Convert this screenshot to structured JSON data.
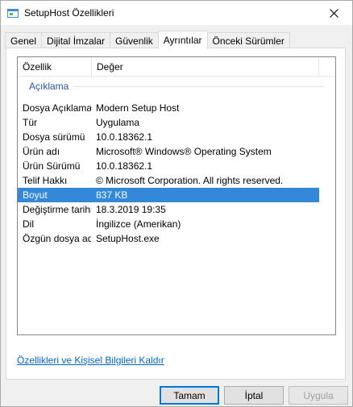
{
  "window": {
    "title": "SetupHost Özellikleri"
  },
  "tabs": [
    {
      "label": "Genel"
    },
    {
      "label": "Dijital İmzalar"
    },
    {
      "label": "Güvenlik"
    },
    {
      "label": "Ayrıntılar",
      "active": true
    },
    {
      "label": "Önceki Sürümler"
    }
  ],
  "details": {
    "columns": {
      "property": "Özellik",
      "value": "Değer"
    },
    "group": "Açıklama",
    "rows": [
      {
        "key": "Dosya Açıklaması",
        "value": "Modern Setup Host"
      },
      {
        "key": "Tür",
        "value": "Uygulama"
      },
      {
        "key": "Dosya sürümü",
        "value": "10.0.18362.1"
      },
      {
        "key": "Ürün adı",
        "value": "Microsoft® Windows® Operating System"
      },
      {
        "key": "Ürün Sürümü",
        "value": "10.0.18362.1"
      },
      {
        "key": "Telif Hakkı",
        "value": "© Microsoft Corporation. All rights reserved."
      },
      {
        "key": "Boyut",
        "value": "837 KB",
        "selected": true
      },
      {
        "key": "Değiştirme tarihi",
        "value": "18.3.2019 19:35"
      },
      {
        "key": "Dil",
        "value": "İngilizce (Amerikan)"
      },
      {
        "key": "Özgün dosya adı",
        "value": "SetupHost.exe"
      }
    ]
  },
  "remove_link": "Özellikleri ve Kişisel Bilgileri Kaldır",
  "buttons": {
    "ok": "Tamam",
    "cancel": "İptal",
    "apply": "Uygula"
  },
  "colors": {
    "selection": "#3388d8",
    "link": "#0066cc",
    "group_label": "#2855a8",
    "default_button_border": "#0078d7"
  }
}
